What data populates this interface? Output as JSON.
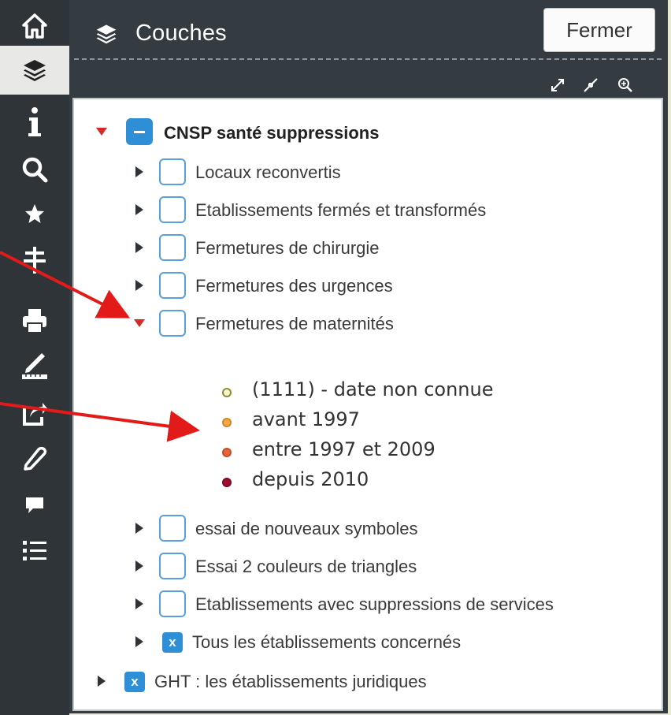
{
  "toolbar": {
    "buttons": [
      {
        "id": "home",
        "icon": "home-icon"
      },
      {
        "id": "layers",
        "icon": "layers-icon",
        "active": true
      },
      {
        "id": "info",
        "icon": "info-icon"
      },
      {
        "id": "search",
        "icon": "search-icon"
      },
      {
        "id": "favorites",
        "icon": "star-icon"
      },
      {
        "id": "measure",
        "icon": "pole-icon"
      },
      {
        "id": "print",
        "icon": "print-icon"
      },
      {
        "id": "draw",
        "icon": "draw-ruler-icon"
      },
      {
        "id": "share",
        "icon": "share-icon"
      },
      {
        "id": "edit",
        "icon": "pencil-icon"
      },
      {
        "id": "comment",
        "icon": "comment-icon"
      },
      {
        "id": "list",
        "icon": "list-icon"
      }
    ]
  },
  "panel": {
    "title": "Couches",
    "close_label": "Fermer",
    "tools": [
      "expand-icon",
      "collapse-icon",
      "zoom-in-icon"
    ]
  },
  "tree": {
    "root": {
      "label": "CNSP santé suppressions",
      "state": "partial",
      "expanded": true
    },
    "children": [
      {
        "label": "Locaux reconvertis",
        "checked": false,
        "expanded": false
      },
      {
        "label": "Etablissements fermés et transformés",
        "checked": false,
        "expanded": false
      },
      {
        "label": "Fermetures de chirurgie",
        "checked": false,
        "expanded": false
      },
      {
        "label": "Fermetures des urgences",
        "checked": false,
        "expanded": false
      },
      {
        "label": "Fermetures de maternités",
        "checked": false,
        "expanded": true
      },
      {
        "label": "essai de nouveaux symboles",
        "checked": false,
        "expanded": false
      },
      {
        "label": "Essai 2 couleurs de triangles",
        "checked": false,
        "expanded": false
      },
      {
        "label": "Etablissements avec suppressions de services",
        "checked": false,
        "expanded": false
      },
      {
        "label": "Tous les établissements concernés",
        "checked": true,
        "expanded": false
      }
    ],
    "legend": [
      {
        "label": "(1111) - date non connue",
        "color": "#fbf8c8",
        "border": "#8a8a3a"
      },
      {
        "label": "avant 1997",
        "color": "#f3a94a",
        "border": "#d0852a"
      },
      {
        "label": "entre 1997 et 2009",
        "color": "#e5663a",
        "border": "#c4502a"
      },
      {
        "label": "depuis 2010",
        "color": "#9e1030",
        "border": "#7e0a22"
      }
    ],
    "second_root": {
      "label": "GHT : les établissements juridiques",
      "checked": true,
      "expanded": false
    }
  },
  "colors": {
    "annotation": "#e21a1a",
    "checkbox_border": "#5aa0d8",
    "checkbox_fill": "#2f8fd6",
    "panel_bg": "#343c42"
  }
}
